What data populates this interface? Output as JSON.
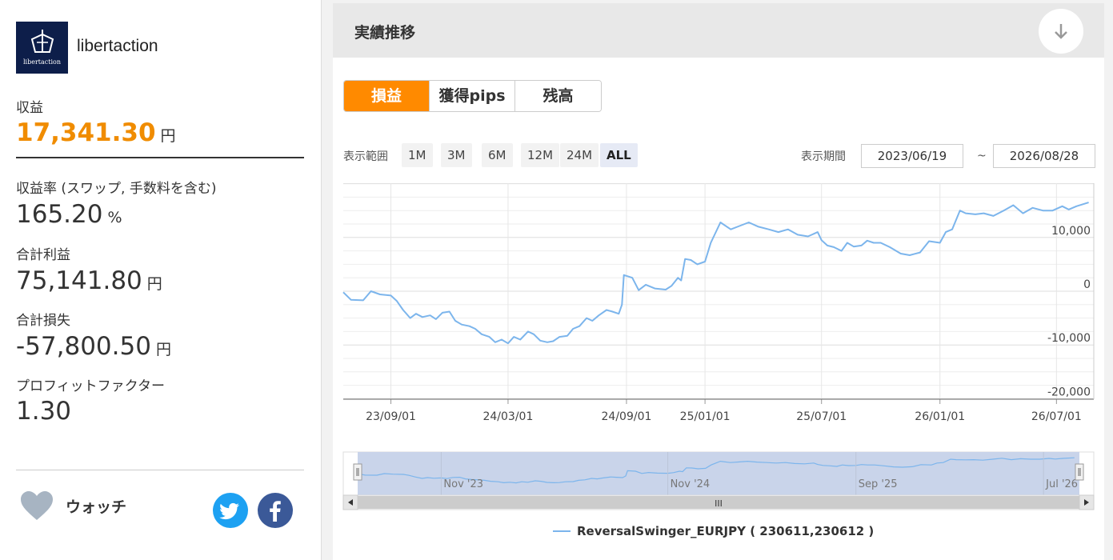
{
  "brand": {
    "name": "libertaction",
    "logo_text": "libertaction"
  },
  "stats": {
    "profit_label": "収益",
    "profit_value": "17,341.30",
    "profit_unit": "円",
    "rate_label": "収益率 (スワップ, 手数料を含む)",
    "rate_value": "165.20",
    "rate_unit": "%",
    "gross_profit_label": "合計利益",
    "gross_profit_value": "75,141.80",
    "gross_profit_unit": "円",
    "gross_loss_label": "合計損失",
    "gross_loss_value": "-57,800.50",
    "gross_loss_unit": "円",
    "pf_label": "プロフィットファクター",
    "pf_value": "1.30"
  },
  "watch": {
    "label": "ウォッチ"
  },
  "panel": {
    "title": "実績推移"
  },
  "tabs": [
    {
      "label": "損益",
      "active": true
    },
    {
      "label": "獲得pips",
      "active": false
    },
    {
      "label": "残高",
      "active": false
    }
  ],
  "range": {
    "label": "表示範囲",
    "buttons": [
      "1M",
      "3M",
      "6M",
      "12M",
      "24M",
      "ALL"
    ],
    "active": "ALL",
    "period_label": "表示期間",
    "from": "2023/06/19",
    "tilde": "~",
    "to": "2026/08/28"
  },
  "colors": {
    "accent": "#ff8a00",
    "profit": "#f08c00",
    "line": "#7cb5ec",
    "navigator_fill": "#c9d4ea"
  },
  "chart_data": {
    "type": "line",
    "series": [
      {
        "name": "ReversalSwinger_EURJPY ( 230611,230612 )"
      }
    ],
    "x_tick_labels": [
      "23/09/01",
      "24/03/01",
      "24/09/01",
      "25/01/01",
      "25/07/01",
      "26/01/01",
      "26/07/01"
    ],
    "y_tick_labels": [
      "10,000",
      "0",
      "-10,000",
      "-20,000"
    ],
    "ylim": [
      -20000,
      20000
    ],
    "navigator_labels": [
      "Nov '23",
      "Nov '24",
      "Sep '25",
      "Jul '26"
    ],
    "points": [
      [
        "2023-06-19",
        -200
      ],
      [
        "2023-07-01",
        -1600
      ],
      [
        "2023-07-20",
        -1700
      ],
      [
        "2023-08-01",
        0
      ],
      [
        "2023-08-15",
        -600
      ],
      [
        "2023-09-01",
        -800
      ],
      [
        "2023-09-10",
        -1800
      ],
      [
        "2023-09-20",
        -3500
      ],
      [
        "2023-10-01",
        -5000
      ],
      [
        "2023-10-10",
        -4200
      ],
      [
        "2023-10-20",
        -4800
      ],
      [
        "2023-11-01",
        -4500
      ],
      [
        "2023-11-10",
        -5200
      ],
      [
        "2023-11-20",
        -4000
      ],
      [
        "2023-12-01",
        -3800
      ],
      [
        "2023-12-10",
        -5500
      ],
      [
        "2023-12-20",
        -6200
      ],
      [
        "2024-01-01",
        -6500
      ],
      [
        "2024-01-10",
        -7000
      ],
      [
        "2024-01-20",
        -8000
      ],
      [
        "2024-02-01",
        -8500
      ],
      [
        "2024-02-10",
        -9500
      ],
      [
        "2024-02-20",
        -9000
      ],
      [
        "2024-03-01",
        -9700
      ],
      [
        "2024-03-10",
        -8500
      ],
      [
        "2024-03-20",
        -9000
      ],
      [
        "2024-04-01",
        -7500
      ],
      [
        "2024-04-10",
        -8000
      ],
      [
        "2024-04-20",
        -9200
      ],
      [
        "2024-05-01",
        -9500
      ],
      [
        "2024-05-10",
        -9300
      ],
      [
        "2024-05-20",
        -8500
      ],
      [
        "2024-06-01",
        -8300
      ],
      [
        "2024-06-10",
        -7000
      ],
      [
        "2024-06-20",
        -6500
      ],
      [
        "2024-07-01",
        -5000
      ],
      [
        "2024-07-10",
        -5500
      ],
      [
        "2024-07-20",
        -4500
      ],
      [
        "2024-08-01",
        -3500
      ],
      [
        "2024-08-10",
        -3800
      ],
      [
        "2024-08-20",
        -4200
      ],
      [
        "2024-08-25",
        -2500
      ],
      [
        "2024-08-28",
        3000
      ],
      [
        "2024-09-10",
        2500
      ],
      [
        "2024-09-20",
        200
      ],
      [
        "2024-10-01",
        1200
      ],
      [
        "2024-10-15",
        500
      ],
      [
        "2024-11-01",
        300
      ],
      [
        "2024-11-10",
        1000
      ],
      [
        "2024-11-20",
        2500
      ],
      [
        "2024-11-25",
        2000
      ],
      [
        "2024-12-01",
        6000
      ],
      [
        "2024-12-10",
        5800
      ],
      [
        "2024-12-20",
        5000
      ],
      [
        "2025-01-01",
        5500
      ],
      [
        "2025-01-10",
        9000
      ],
      [
        "2025-01-25",
        12800
      ],
      [
        "2025-02-10",
        11500
      ],
      [
        "2025-02-25",
        12200
      ],
      [
        "2025-03-10",
        12800
      ],
      [
        "2025-03-25",
        12000
      ],
      [
        "2025-04-10",
        11500
      ],
      [
        "2025-04-25",
        11000
      ],
      [
        "2025-05-10",
        11500
      ],
      [
        "2025-05-25",
        10500
      ],
      [
        "2025-06-10",
        10200
      ],
      [
        "2025-06-25",
        11000
      ],
      [
        "2025-07-01",
        9500
      ],
      [
        "2025-07-10",
        8500
      ],
      [
        "2025-07-20",
        8200
      ],
      [
        "2025-08-01",
        7500
      ],
      [
        "2025-08-10",
        9000
      ],
      [
        "2025-08-20",
        8300
      ],
      [
        "2025-09-01",
        8500
      ],
      [
        "2025-09-10",
        9400
      ],
      [
        "2025-09-20",
        9000
      ],
      [
        "2025-10-01",
        9000
      ],
      [
        "2025-10-15",
        8200
      ],
      [
        "2025-11-01",
        7000
      ],
      [
        "2025-11-15",
        6700
      ],
      [
        "2025-12-01",
        7200
      ],
      [
        "2025-12-15",
        9300
      ],
      [
        "2026-01-01",
        9000
      ],
      [
        "2026-01-10",
        11000
      ],
      [
        "2026-01-20",
        11500
      ],
      [
        "2026-02-01",
        15000
      ],
      [
        "2026-02-10",
        14500
      ],
      [
        "2026-02-25",
        14300
      ],
      [
        "2026-03-10",
        14500
      ],
      [
        "2026-03-25",
        14000
      ],
      [
        "2026-04-10",
        15000
      ],
      [
        "2026-04-25",
        16000
      ],
      [
        "2026-05-10",
        14500
      ],
      [
        "2026-05-25",
        15500
      ],
      [
        "2026-06-10",
        15000
      ],
      [
        "2026-06-25",
        15000
      ],
      [
        "2026-07-10",
        15800
      ],
      [
        "2026-07-20",
        15200
      ],
      [
        "2026-08-01",
        15800
      ],
      [
        "2026-08-20",
        16500
      ]
    ]
  },
  "navigator": {
    "scroll_icon": "III"
  }
}
